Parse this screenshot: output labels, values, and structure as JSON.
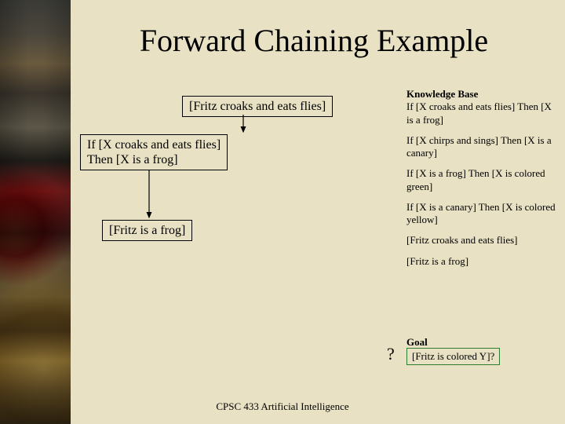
{
  "title": "Forward Chaining Example",
  "footer": "CPSC 433 Artificial Intelligence",
  "boxes": {
    "fact1": "[Fritz croaks and eats flies]",
    "rule1": "If [X croaks and eats flies]\nThen [X is a frog]",
    "fact2": "[Fritz is a frog]"
  },
  "kb": {
    "header": "Knowledge Base",
    "r1": "If [X croaks and eats flies]\nThen [X is a frog]",
    "r2": "If [X chirps and sings]\nThen [X is a canary]",
    "r3": "If [X is a frog]\nThen [X is colored green]",
    "r4": "If [X is a canary]\nThen [X is colored yellow]",
    "f1": "[Fritz croaks and eats flies]",
    "f2": "[Fritz is a frog]"
  },
  "goal": {
    "label": "Goal",
    "text": "[Fritz is colored Y]?"
  },
  "qmark": "?"
}
